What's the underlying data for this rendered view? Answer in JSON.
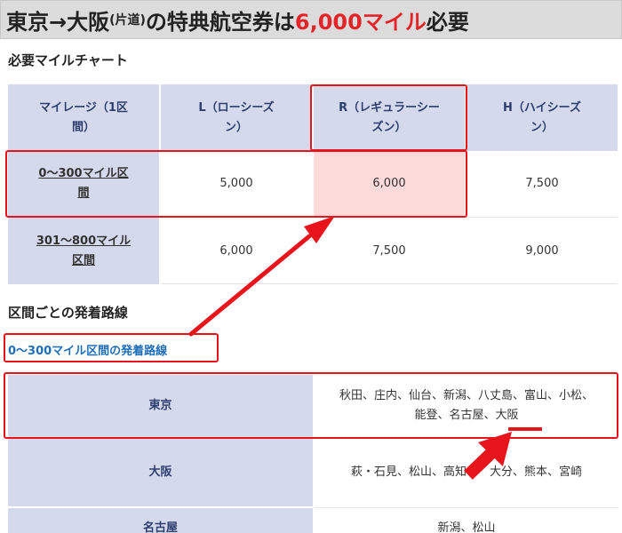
{
  "banner": {
    "route": "東京→大阪",
    "note": "(片道)",
    "mid": "の特典航空券は",
    "miles": "6,000マイル",
    "tail": "必要"
  },
  "chart_heading": "必要マイルチャート",
  "mileage_table": {
    "headers": [
      "マイレージ（1区間）",
      "L（ローシーズン）",
      "R（レギュラーシーズン）",
      "H（ハイシーズン）"
    ],
    "rows": [
      {
        "label": "0〜300マイル区間",
        "values": [
          "5,000",
          "6,000",
          "7,500"
        ]
      },
      {
        "label": "301〜800マイル区間",
        "values": [
          "6,000",
          "7,500",
          "9,000"
        ]
      }
    ]
  },
  "routes_heading": "区間ごとの発着路線",
  "routes_subheading": "0〜300マイル区間の発着路線",
  "routes_table": [
    {
      "origin": "東京",
      "destinations": "秋田、庄内、仙台、新潟、八丈島、富山、小松、能登、名古屋、大阪"
    },
    {
      "origin": "大阪",
      "destinations": "萩・石見、松山、高知　　大分、熊本、宮崎"
    },
    {
      "origin": "名古屋",
      "destinations": "新潟、松山"
    }
  ],
  "colors": {
    "accent_red": "#e8141b",
    "header_blue": "#d4d9ec",
    "highlight_pink": "#fcdada",
    "link_blue": "#1e6eb8"
  }
}
